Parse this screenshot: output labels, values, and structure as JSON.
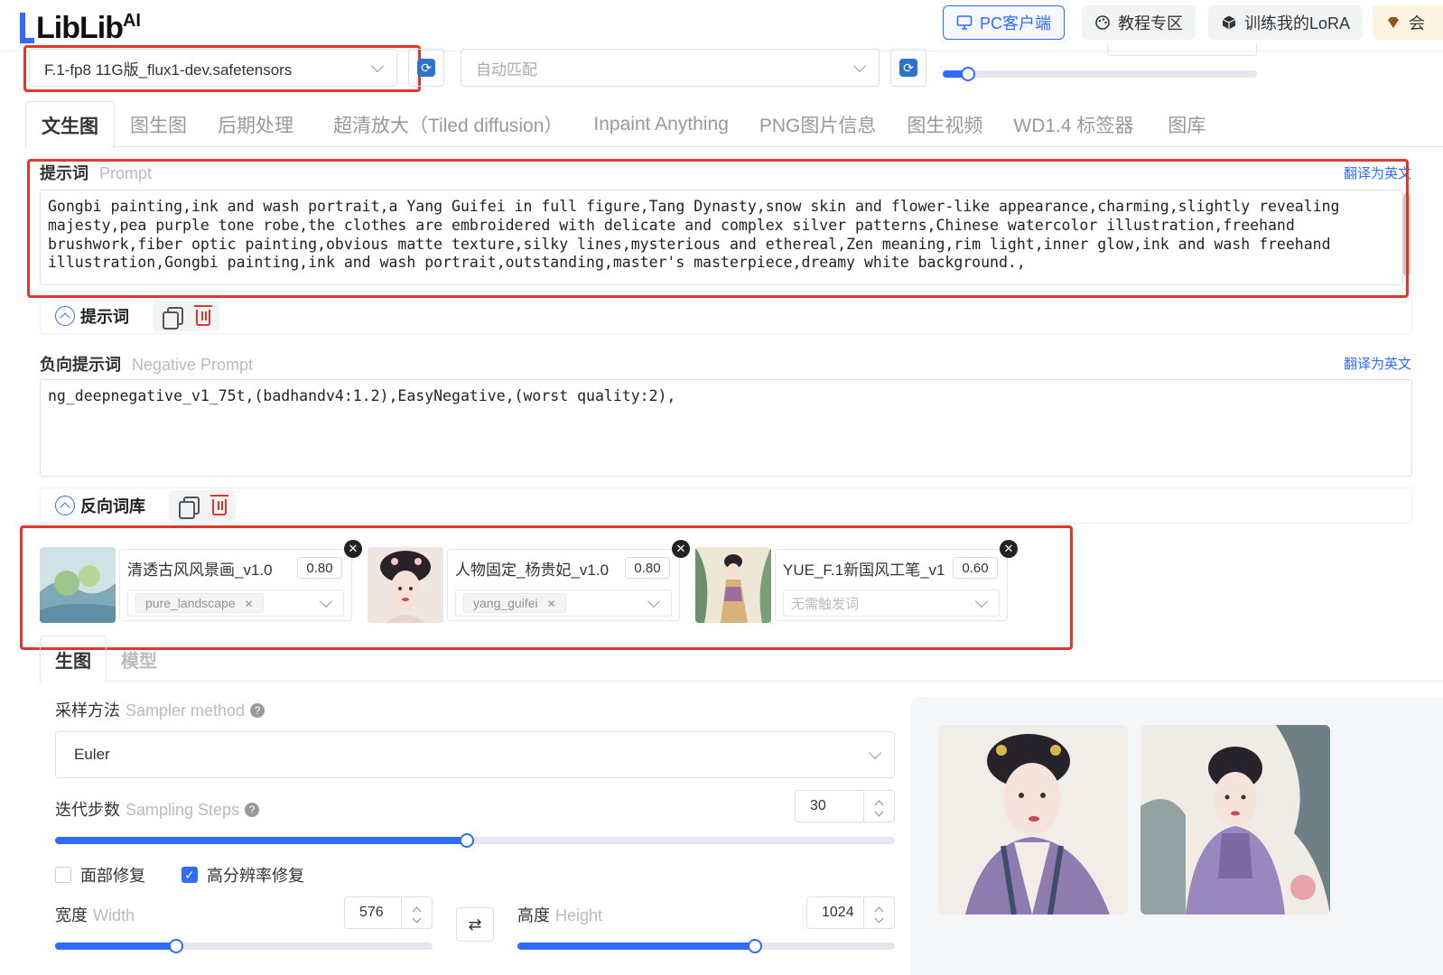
{
  "header": {
    "logo_text": "LibLib",
    "logo_sup": "AI",
    "buttons": [
      {
        "label": "PC客户端",
        "icon": "monitor-icon"
      },
      {
        "label": "教程专区",
        "icon": "palette-icon"
      },
      {
        "label": "训练我的LoRA",
        "icon": "cube-icon"
      },
      {
        "label": "会",
        "icon": "vip-diamond-icon"
      }
    ]
  },
  "model_bar": {
    "checkpoint": "F.1-fp8 11G版_flux1-dev.safetensors",
    "vae_placeholder": "自动匹配",
    "clip_skip_value": 0.08
  },
  "tabs": [
    "文生图",
    "图生图",
    "后期处理",
    "超清放大（Tiled diffusion）",
    "Inpaint Anything",
    "PNG图片信息",
    "图生视频",
    "WD1.4 标签器",
    "图库"
  ],
  "prompt": {
    "label": "提示词",
    "label_en": "Prompt",
    "translate": "翻译为英文",
    "text": "Gongbi painting,ink and wash portrait,a Yang Guifei in full figure,Tang Dynasty,snow skin and flower-like appearance,charming,slightly revealing majesty,pea purple tone robe,the clothes are embroidered with delicate and complex silver patterns,Chinese watercolor illustration,freehand brushwork,fiber optic painting,obvious matte texture,silky lines,mysterious and ethereal,Zen meaning,rim light,inner glow,ink and wash freehand illustration,Gongbi painting,ink and wash portrait,outstanding,master's masterpiece,dreamy white background.,",
    "toolbar_label": "提示词"
  },
  "negative": {
    "label": "负向提示词",
    "label_en": "Negative Prompt",
    "translate": "翻译为英文",
    "text": "ng_deepnegative_v1_75t,(badhandv4:1.2),EasyNegative,(worst quality:2),",
    "toolbar_label": "反向词库"
  },
  "loras": [
    {
      "name": "清透古风风景画_v1.0",
      "weight": "0.80",
      "trigger": "pure_landscape",
      "trigger_placeholder": ""
    },
    {
      "name": "人物固定_杨贵妃_v1.0",
      "weight": "0.80",
      "trigger": "yang_guifei",
      "trigger_placeholder": ""
    },
    {
      "name": "YUE_F.1新国风工笔_v1",
      "weight": "0.60",
      "trigger": "",
      "trigger_placeholder": "无需触发词"
    }
  ],
  "subtabs": [
    "生图",
    "模型"
  ],
  "sampler": {
    "label": "采样方法",
    "label_en": "Sampler method",
    "value": "Euler"
  },
  "steps": {
    "label": "迭代步数",
    "label_en": "Sampling Steps",
    "value": "30",
    "fraction": 0.49
  },
  "checkboxes": [
    {
      "label": "面部修复",
      "checked": false
    },
    {
      "label": "高分辨率修复",
      "checked": true
    }
  ],
  "width": {
    "label": "宽度",
    "label_en": "Width",
    "value": "576",
    "fraction": 0.32
  },
  "height": {
    "label": "高度",
    "label_en": "Height",
    "value": "1024",
    "fraction": 0.63
  },
  "swap_icon": "swap-arrows-icon",
  "colors": {
    "accent": "#2f6bff",
    "highlight": "#e0362c"
  }
}
